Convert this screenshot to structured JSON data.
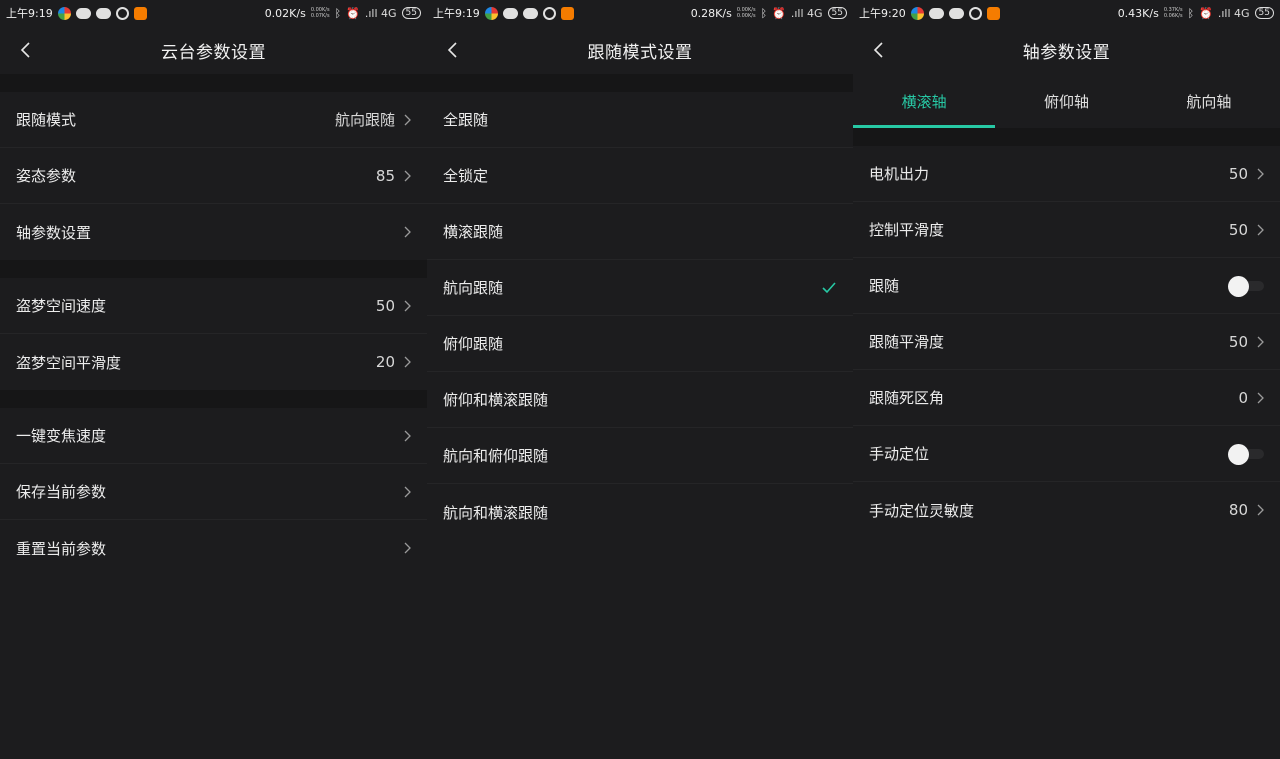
{
  "colors": {
    "accent": "#27c9a5",
    "background": "#1c1c1e",
    "section_gap": "#161617"
  },
  "screen1": {
    "status": {
      "time": "上午9:19",
      "speed": "0.02K/s",
      "up": "0.00K/s",
      "down": "0.07K/s",
      "signal": ".ıll 4G",
      "battery": "55"
    },
    "title": "云台参数设置",
    "group1": [
      {
        "label": "跟随模式",
        "value": "航向跟随"
      },
      {
        "label": "姿态参数",
        "value": "85"
      },
      {
        "label": "轴参数设置",
        "value": ""
      }
    ],
    "group2": [
      {
        "label": "盗梦空间速度",
        "value": "50"
      },
      {
        "label": "盗梦空间平滑度",
        "value": "20"
      }
    ],
    "group3": [
      {
        "label": "一键变焦速度",
        "value": ""
      },
      {
        "label": "保存当前参数",
        "value": ""
      },
      {
        "label": "重置当前参数",
        "value": ""
      }
    ]
  },
  "screen2": {
    "status": {
      "time": "上午9:19",
      "speed": "0.28K/s",
      "up": "0.00K/s",
      "down": "0.00K/s",
      "signal": ".ıll 4G",
      "battery": "55"
    },
    "title": "跟随模式设置",
    "options": [
      {
        "label": "全跟随",
        "selected": false
      },
      {
        "label": "全锁定",
        "selected": false
      },
      {
        "label": "横滚跟随",
        "selected": false
      },
      {
        "label": "航向跟随",
        "selected": true
      },
      {
        "label": "俯仰跟随",
        "selected": false
      },
      {
        "label": "俯仰和横滚跟随",
        "selected": false
      },
      {
        "label": "航向和俯仰跟随",
        "selected": false
      },
      {
        "label": "航向和横滚跟随",
        "selected": false
      }
    ]
  },
  "screen3": {
    "status": {
      "time": "上午9:20",
      "speed": "0.43K/s",
      "up": "0.37K/s",
      "down": "0.06K/s",
      "signal": ".ıll 4G",
      "battery": "55"
    },
    "title": "轴参数设置",
    "tabs": [
      {
        "label": "横滚轴",
        "active": true
      },
      {
        "label": "俯仰轴",
        "active": false
      },
      {
        "label": "航向轴",
        "active": false
      }
    ],
    "rows": [
      {
        "label": "电机出力",
        "value": "50",
        "kind": "value"
      },
      {
        "label": "控制平滑度",
        "value": "50",
        "kind": "value"
      },
      {
        "label": "跟随",
        "value": "",
        "kind": "toggle",
        "on": false
      },
      {
        "label": "跟随平滑度",
        "value": "50",
        "kind": "value"
      },
      {
        "label": "跟随死区角",
        "value": "0",
        "kind": "value"
      },
      {
        "label": "手动定位",
        "value": "",
        "kind": "toggle",
        "on": false
      },
      {
        "label": "手动定位灵敏度",
        "value": "80",
        "kind": "value"
      }
    ]
  }
}
